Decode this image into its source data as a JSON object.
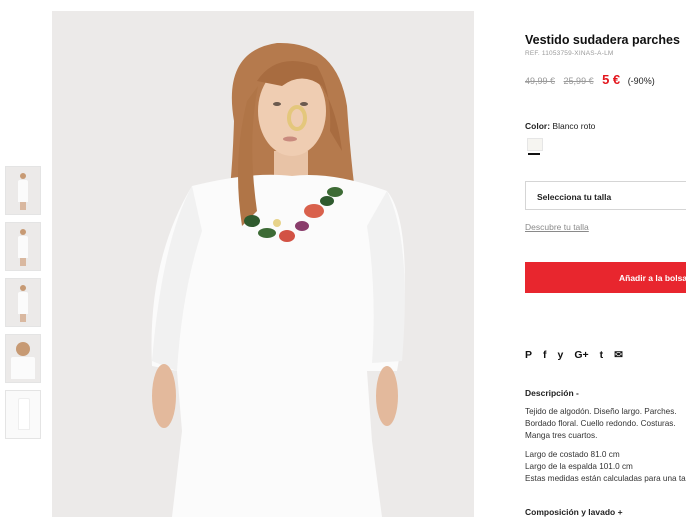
{
  "product": {
    "title": "Vestido sudadera parches",
    "ref": "REF. 11053759-XINAS-A-LM",
    "price_old_1": "49,99 €",
    "price_old_2": "25,99 €",
    "price_sale": "5 €",
    "discount": "(-90%)",
    "color_label": "Color:",
    "color_value": "Blanco roto",
    "size_select": "Selecciona tu talla",
    "size_guide": "Descubre tu talla",
    "add_button": "Añadir a la bolsa"
  },
  "share_icons": [
    "pinterest-icon",
    "facebook-icon",
    "twitter-icon",
    "google-plus-icon",
    "tumblr-icon",
    "email-icon"
  ],
  "share_glyphs": [
    "P",
    "f",
    "y",
    "G+",
    "t",
    "✉"
  ],
  "description": {
    "heading": "Descripción -",
    "line1": "Tejido de algodón. Diseño largo. Parches.",
    "line2": "Bordado floral. Cuello redondo. Costuras.",
    "line3": "Manga tres cuartos.",
    "line4": "Largo de costado 81.0 cm",
    "line5": "Largo de la espalda 101.0 cm",
    "line6": "Estas medidas están calculadas para una talla M."
  },
  "composition_heading": "Composición y lavado +",
  "colors": {
    "accent": "#e8262e",
    "sale": "#e3161d",
    "image_bg": "#eceae9"
  }
}
